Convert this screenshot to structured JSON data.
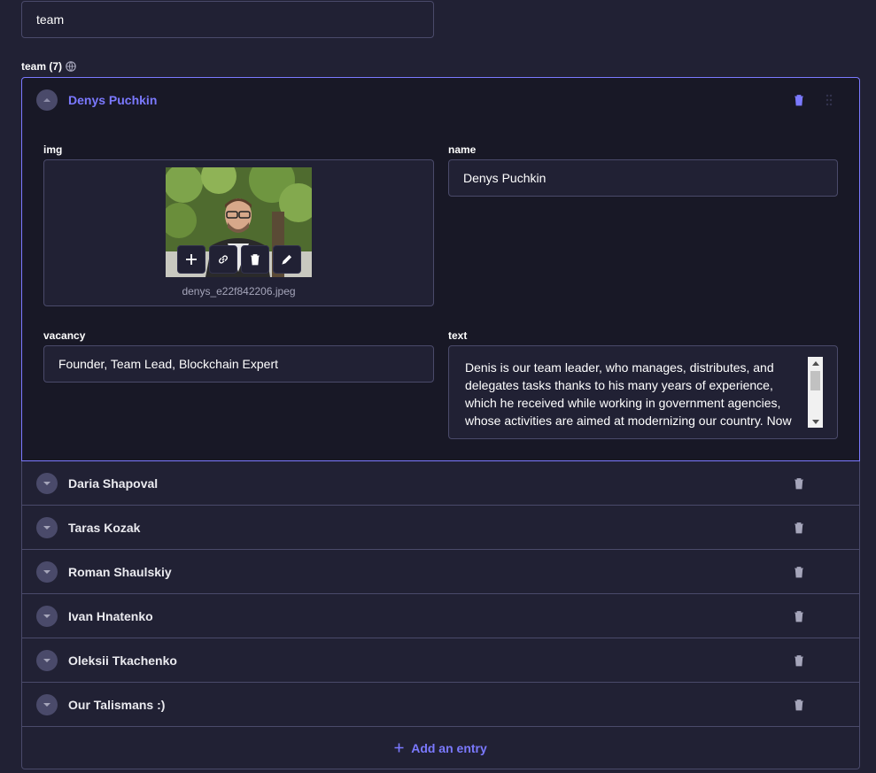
{
  "top_field": {
    "value": "team"
  },
  "section": {
    "label": "team (7)",
    "icon": "globe-icon"
  },
  "open_entry": {
    "title": "Denys Puchkin",
    "fields": {
      "img_label": "img",
      "filename": "denys_e22f842206.jpeg",
      "name_label": "name",
      "name_value": "Denys Puchkin",
      "vacancy_label": "vacancy",
      "vacancy_value": "Founder, Team Lead, Blockchain Expert",
      "text_label": "text",
      "text_value": "Denis is our team leader, who manages, distributes, and delegates tasks thanks to his many years of experience, which he received while working in government agencies, whose activities are aimed at modernizing our country. Now he is"
    }
  },
  "entries": [
    {
      "title": "Daria Shapoval"
    },
    {
      "title": "Taras Kozak"
    },
    {
      "title": "Roman Shaulskiy"
    },
    {
      "title": "Ivan Hnatenko"
    },
    {
      "title": "Oleksii Tkachenko"
    },
    {
      "title": "Our Talismans :)"
    }
  ],
  "add_entry_label": "Add an entry",
  "colors": {
    "accent": "#7b79ff",
    "background": "#212134",
    "panel": "#181826",
    "border": "#4a4a6a"
  }
}
